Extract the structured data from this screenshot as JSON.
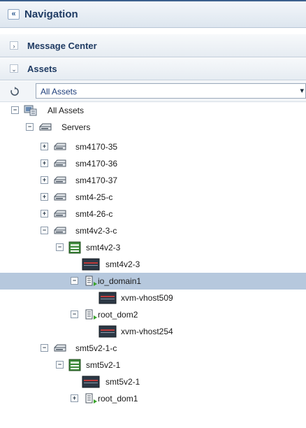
{
  "navigation": {
    "title": "Navigation",
    "collapse_glyph": "«"
  },
  "message_center": {
    "label": "Message Center",
    "glyph": "›"
  },
  "assets": {
    "label": "Assets",
    "glyph": "⌄"
  },
  "view": {
    "selected": "All Assets",
    "arrow": "▾"
  },
  "icons": {
    "refresh": "refresh-icon",
    "server": "server-icon",
    "host": "host-icon",
    "domain": "domain-icon",
    "assets": "all-assets-icon",
    "chassis": "chassis-icon"
  },
  "tree": {
    "all_assets": "All Assets",
    "servers": "Servers",
    "sm4170_35": "sm4170-35",
    "sm4170_36": "sm4170-36",
    "sm4170_37": "sm4170-37",
    "smt4_25_c": "smt4-25-c",
    "smt4_26_c": "smt4-26-c",
    "smt4v2_3_c": "smt4v2-3-c",
    "smt4v2_3_sparc": "smt4v2-3",
    "smt4v2_3_host": "smt4v2-3",
    "io_domain1": "io_domain1",
    "xvm_vhost509": "xvm-vhost509",
    "root_dom2": "root_dom2",
    "xvm_vhost254": "xvm-vhost254",
    "smt5v2_1_c": "smt5v2-1-c",
    "smt5v2_1_sparc": "smt5v2-1",
    "smt5v2_1_host": "smt5v2-1",
    "root_dom1": "root_dom1"
  },
  "toggles": {
    "expanded": "−",
    "collapsed": "+"
  }
}
